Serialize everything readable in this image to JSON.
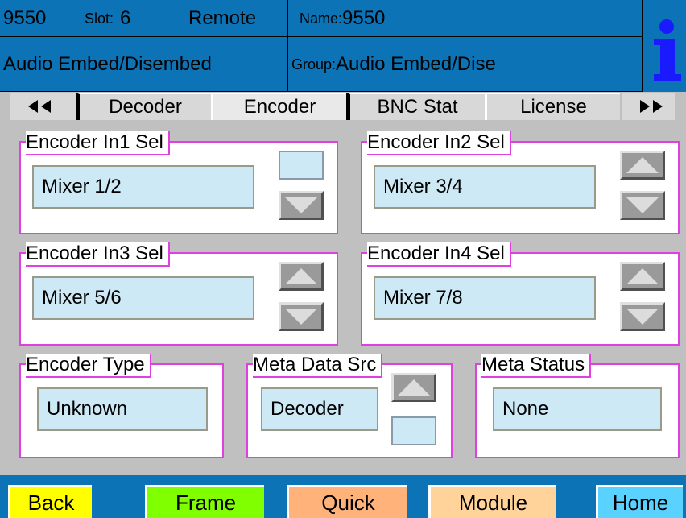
{
  "header": {
    "model": "9550",
    "slot_label": "Slot:",
    "slot_value": "6",
    "mode": "Remote",
    "name_label": "Name:",
    "name_value": "9550",
    "module_title": "Audio Embed/Disembed",
    "group_label": "Group:",
    "group_value": "Audio Embed/Dise",
    "info_icon": "info-icon"
  },
  "tabs": {
    "items": [
      "Decoder",
      "Encoder",
      "BNC Stat",
      "License"
    ],
    "selected": "Encoder",
    "prev_icon": "double-left-arrow-icon",
    "next_icon": "double-right-arrow-icon"
  },
  "controls": {
    "in1": {
      "label": "Encoder In1 Sel",
      "value": "Mixer 1/2"
    },
    "in2": {
      "label": "Encoder In2 Sel",
      "value": "Mixer 3/4"
    },
    "in3": {
      "label": "Encoder In3 Sel",
      "value": "Mixer 5/6"
    },
    "in4": {
      "label": "Encoder In4 Sel",
      "value": "Mixer 7/8"
    },
    "type": {
      "label": "Encoder Type",
      "value": "Unknown"
    },
    "meta_src": {
      "label": "Meta Data Src",
      "value": "Decoder"
    },
    "meta_status": {
      "label": "Meta Status",
      "value": "None"
    }
  },
  "bottom": {
    "back": "Back",
    "frame": "Frame",
    "quick": "Quick",
    "module": "Module",
    "home": "Home"
  },
  "colors": {
    "header_bg": "#0b73b6",
    "panel_border": "#e040e0",
    "value_bg": "#cde9f6",
    "back_bg": "#ffff00",
    "frame_bg": "#80ff00",
    "quick_bg": "#ffb27a",
    "module_bg": "#ffd39a",
    "home_bg": "#5ad2ff"
  }
}
